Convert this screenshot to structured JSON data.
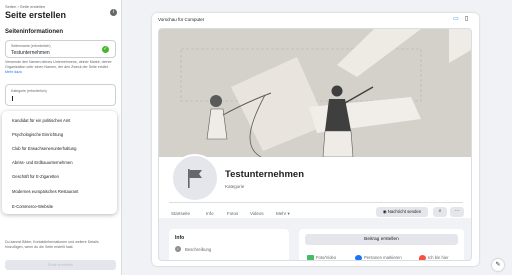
{
  "breadcrumb": "Seiten › Seite erstellen",
  "page_title": "Seite erstellen",
  "section_title": "Seiteninformationen",
  "name_field": {
    "label": "Seitenname (erforderlich)",
    "value": "Testunternehmen"
  },
  "help_text": "Verwende den Namen deines Unternehmens, deiner Marke, deiner Organisation oder einen Namen, der den Zweck der Seite erklärt.",
  "help_link": "Mehr dazu",
  "category_field": {
    "label": "Kategorie (erforderlich)"
  },
  "dropdown_items": [
    "Kandidat für ein politisches Amt",
    "Psychologische Einrichtung",
    "Club für Erwachsenenunterhaltung",
    "Abriss- und Erdbauunternehmen",
    "Geschäft für E-Zigaretten",
    "Modernes europäisches Restaurant",
    "E-Commerce-Website"
  ],
  "bottom_note": "Du kannst Bilder, Kontaktinformationen und weitere Details hinzufügen, wenn du die Seite erstellt hast.",
  "create_button": "Seite erstellen",
  "preview": {
    "label": "Vorschau für Computer",
    "page_name": "Testunternehmen",
    "category": "Kategorie",
    "tabs": [
      "Startseite",
      "Info",
      "Fotos",
      "Videos",
      "Mehr ▾"
    ],
    "message_button": "Nachricht senden",
    "info_title": "Info",
    "info_desc": "Beschreibung",
    "post_button": "Beitrag erstellen",
    "actions": [
      "Foto/Video",
      "Personen markieren",
      "Ich bin hier"
    ]
  },
  "colors": {
    "accent": "#1877f2",
    "success": "#42b72a",
    "photo": "#45bd62",
    "tag": "#1877f2",
    "checkin": "#f5533d"
  }
}
